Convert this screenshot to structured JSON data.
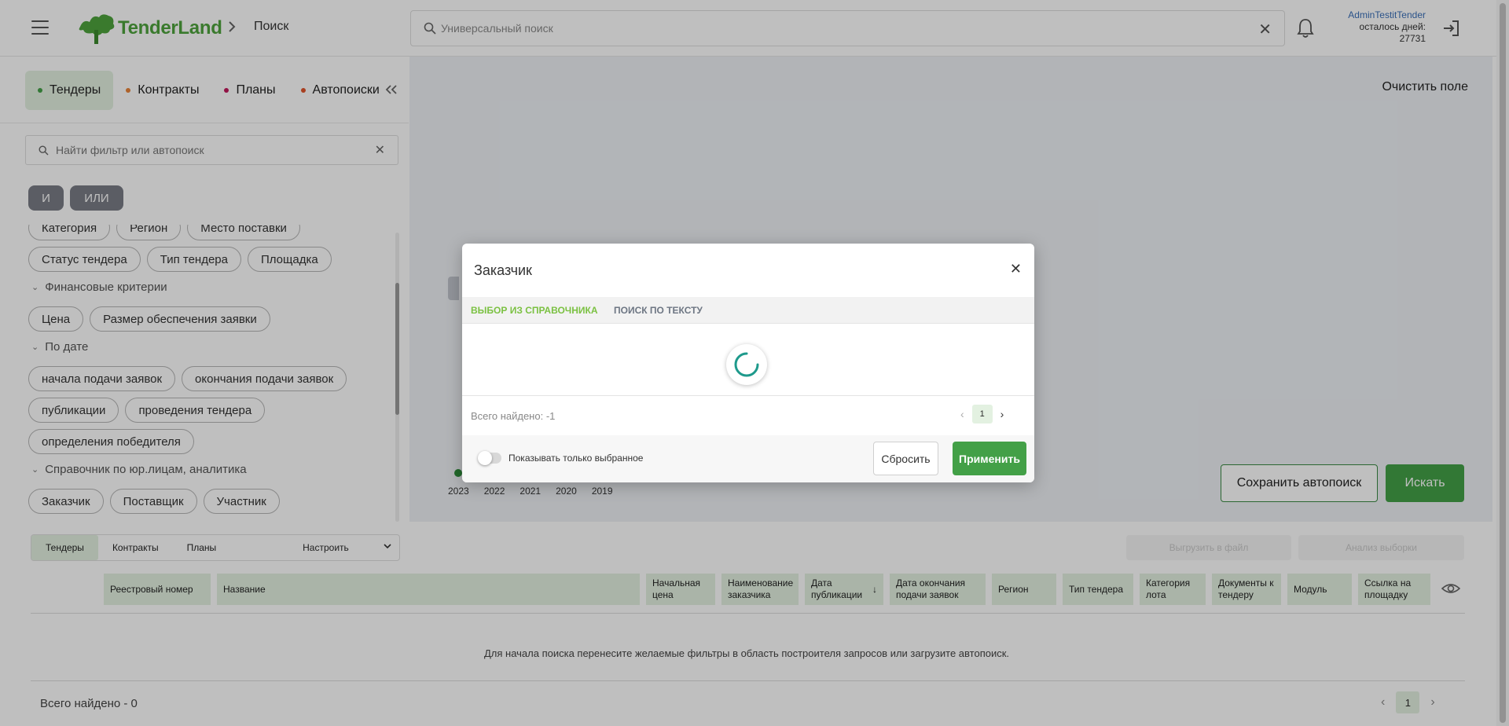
{
  "header": {
    "brand": "TenderLand",
    "breadcrumb": "Поиск",
    "search_placeholder": "Универсальный поиск",
    "user_name": "AdminTestitTender",
    "days_label": "осталось дней:",
    "days_value": "27731"
  },
  "sidebar": {
    "tabs": [
      {
        "label": "Тендеры",
        "dot": "#43a047"
      },
      {
        "label": "Контракты",
        "dot": "#e8833a"
      },
      {
        "label": "Планы",
        "dot": "#c2185b"
      },
      {
        "label": "Автопоиски",
        "dot": "#e0552b"
      }
    ],
    "filter_search_placeholder": "Найти фильтр или автопоиск",
    "logic_and": "И",
    "logic_or": "ИЛИ",
    "row1": [
      "Категория",
      "Регион",
      "Место поставки"
    ],
    "row2": [
      "Статус тендера",
      "Тип тендера",
      "Площадка"
    ],
    "group_finance": "Финансовые критерии",
    "row3": [
      "Цена",
      "Размер обеспечения заявки"
    ],
    "group_date": "По дате",
    "row4": [
      "начала подачи заявок",
      "окончания подачи заявок"
    ],
    "row5": [
      "публикации",
      "проведения тендера"
    ],
    "row6": [
      "определения победителя"
    ],
    "group_legal": "Справочник по юр.лицам, аналитика",
    "row7": [
      "Заказчик",
      "Поставщик",
      "Участник"
    ]
  },
  "builder": {
    "clear_field": "Очистить поле",
    "years": [
      "2023",
      "2022",
      "2021",
      "2020",
      "2019"
    ],
    "save_autosearch": "Сохранить автопоиск",
    "search": "Искать"
  },
  "results": {
    "tabs": [
      "Тендеры",
      "Контракты",
      "Планы"
    ],
    "configure": "Настроить",
    "export": "Выгрузить в файл",
    "analysis": "Анализ выборки",
    "columns": [
      "Реестровый номер",
      "Название",
      "Начальная цена",
      "Наименование заказчика",
      "Дата публикации",
      "Дата окончания подачи заявок",
      "Регион",
      "Тип тендера",
      "Категория лота",
      "Документы к тендеру",
      "Модуль",
      "Ссылка на площадку"
    ],
    "empty_message": "Для начала поиска перенесите желаемые фильтры в область построителя запросов или загрузите автопоиск.",
    "total": "Всего найдено - 0",
    "page": "1"
  },
  "modal": {
    "title": "Заказчик",
    "tab_directory": "ВЫБОР ИЗ СПРАВОЧНИКА",
    "tab_text": "ПОИСК ПО ТЕКСТУ",
    "found": "Всего найдено: -1",
    "page": "1",
    "show_selected": "Показывать только выбранное",
    "reset": "Сбросить",
    "apply": "Применить"
  }
}
